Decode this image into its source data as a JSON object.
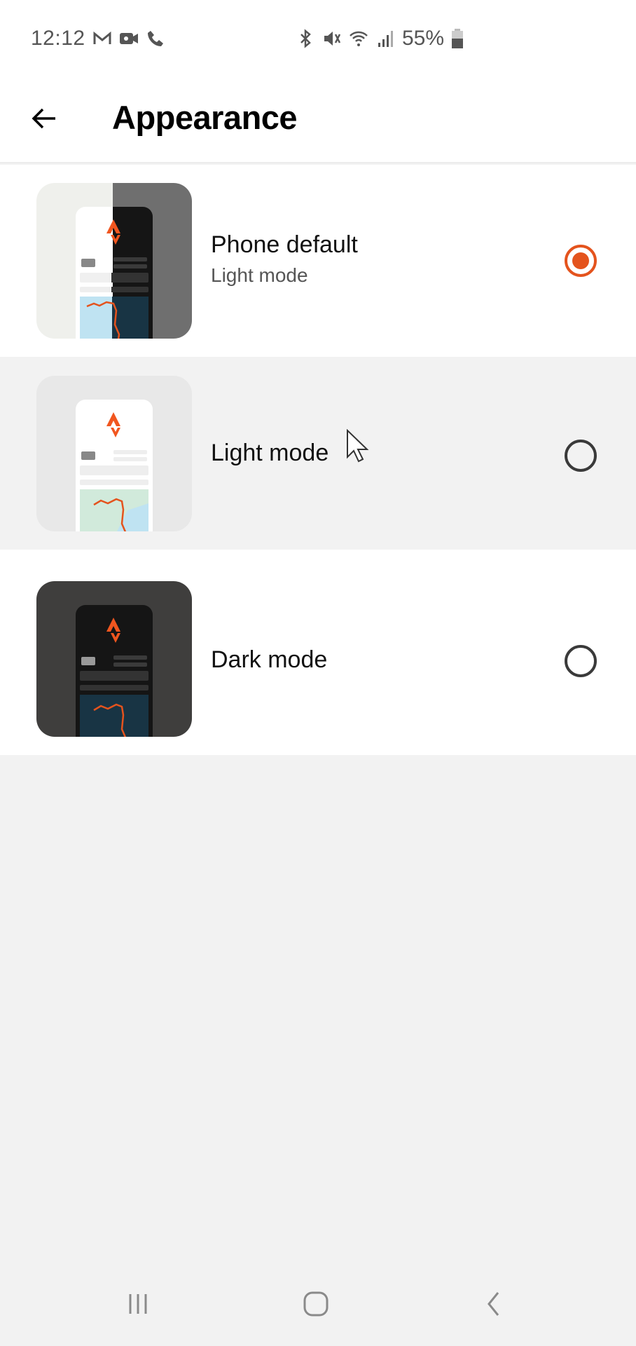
{
  "status_bar": {
    "time": "12:12",
    "left_icons": [
      "gmail-icon",
      "video-call-icon",
      "phone-call-icon"
    ],
    "right_icons": [
      "bluetooth-icon",
      "mute-icon",
      "wifi-icon",
      "signal-icon"
    ],
    "battery_percent": "55%",
    "battery_level": 0.55
  },
  "header": {
    "back_icon": "arrow-left-icon",
    "title": "Appearance"
  },
  "options": [
    {
      "label": "Phone default",
      "sublabel": "Light mode",
      "selected": true,
      "preview": "split-light-dark"
    },
    {
      "label": "Light mode",
      "sublabel": "",
      "selected": false,
      "preview": "light"
    },
    {
      "label": "Dark mode",
      "sublabel": "",
      "selected": false,
      "preview": "dark"
    }
  ],
  "colors": {
    "accent": "#e4531d",
    "row_highlight": "#f2f2f2",
    "background": "#f2f2f2"
  },
  "nav_bar": {
    "recents_icon": "recents-icon",
    "home_icon": "home-icon",
    "back_icon": "back-chevron-icon"
  }
}
